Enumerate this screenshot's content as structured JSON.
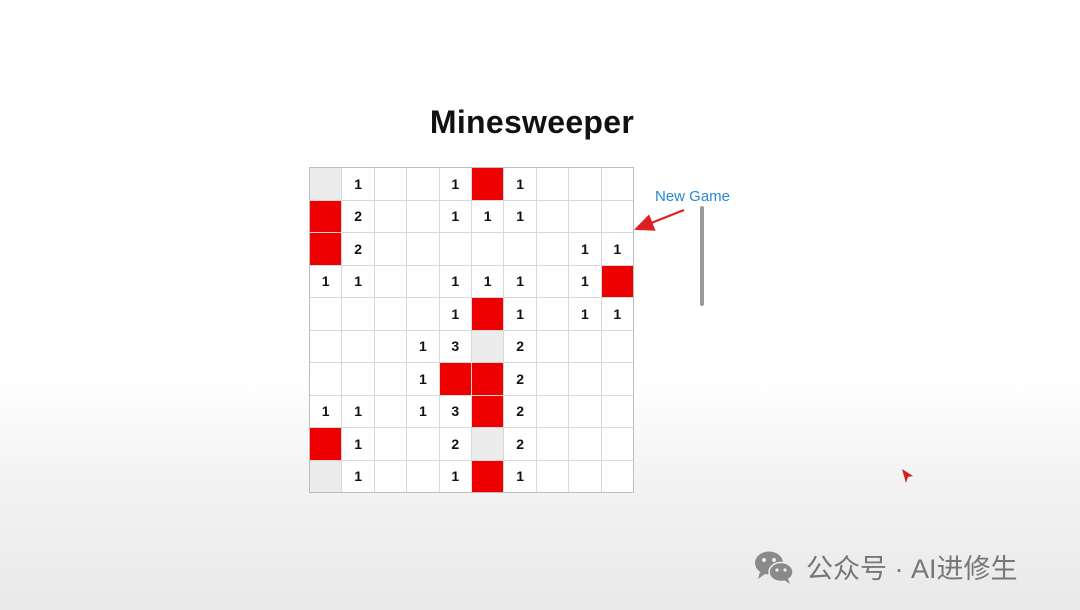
{
  "title": "Minesweeper",
  "new_game_label": "New Game",
  "colors": {
    "mine": "#ee0000",
    "hidden": "#ececec",
    "link": "#2a86d6",
    "annotation": "#e02020"
  },
  "board": {
    "rows": [
      [
        "H",
        "1",
        "",
        "",
        "1",
        "M",
        "1",
        "",
        "",
        ""
      ],
      [
        "M",
        "2",
        "",
        "",
        "1",
        "1",
        "1",
        "",
        "",
        ""
      ],
      [
        "M",
        "2",
        "",
        "",
        "",
        "",
        "",
        "",
        "1",
        "1"
      ],
      [
        "1",
        "1",
        "",
        "",
        "1",
        "1",
        "1",
        "",
        "1",
        "M"
      ],
      [
        "",
        "",
        "",
        "",
        "1",
        "M",
        "1",
        "",
        "1",
        "1"
      ],
      [
        "",
        "",
        "",
        "1",
        "3",
        "H",
        "2",
        "",
        "",
        ""
      ],
      [
        "",
        "",
        "",
        "1",
        "M",
        "M",
        "2",
        "",
        "",
        ""
      ],
      [
        "1",
        "1",
        "",
        "1",
        "3",
        "M",
        "2",
        "",
        "",
        ""
      ],
      [
        "M",
        "1",
        "",
        "",
        "2",
        "H",
        "2",
        "",
        "",
        ""
      ],
      [
        "H",
        "1",
        "",
        "",
        "1",
        "M",
        "1",
        "",
        "",
        ""
      ]
    ]
  },
  "watermark": {
    "logo": "wechat-icon",
    "text": "公众号 · AI进修生"
  }
}
